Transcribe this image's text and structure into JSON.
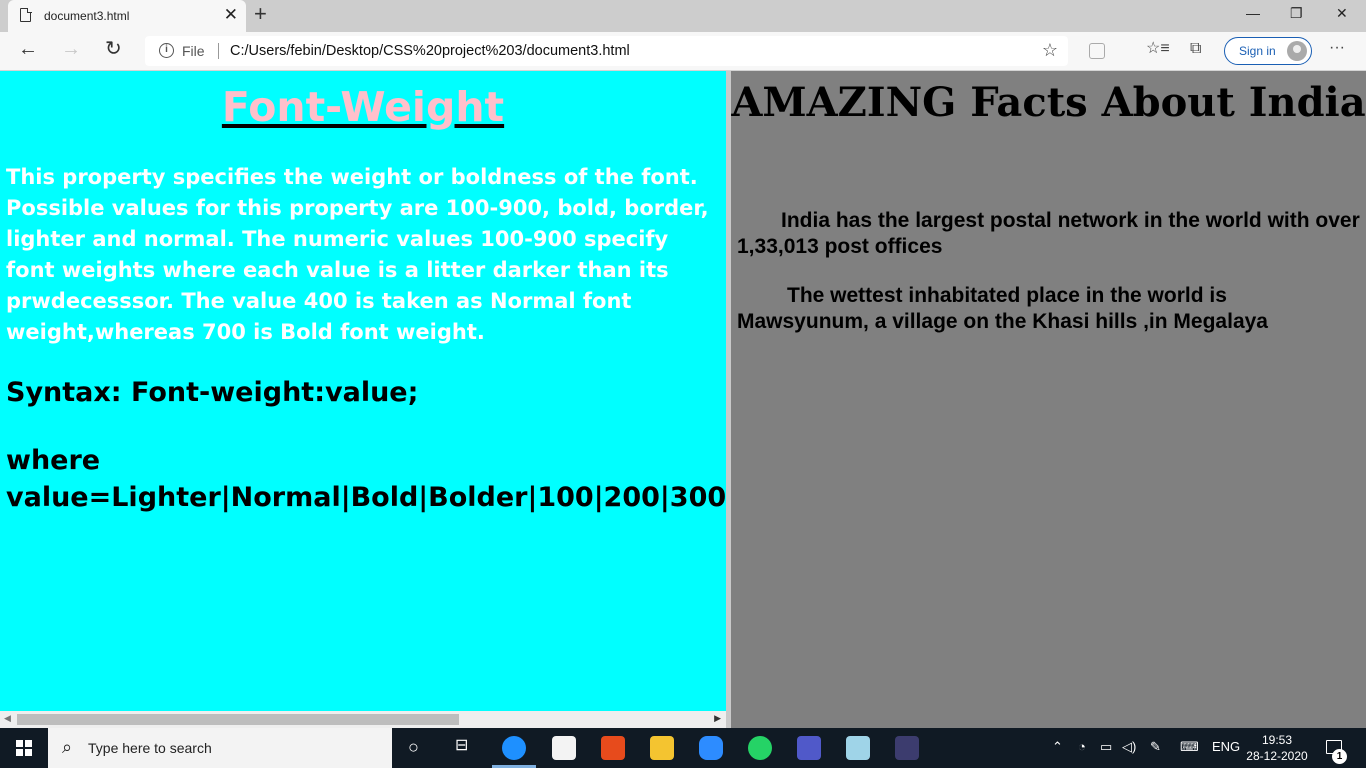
{
  "browser": {
    "tab_title": "document3.html",
    "tab_close": "✕",
    "new_tab": "+",
    "window_controls": {
      "minimize": "—",
      "restore": "❐",
      "close": "✕"
    },
    "scheme_label": "File",
    "url": "C:/Users/febin/Desktop/CSS%20project%203/document3.html",
    "sign_in_label": "Sign in",
    "more_label": "···"
  },
  "left_pane": {
    "title": "Font-Weight",
    "description": "This property specifies the weight or boldness of the font. Possible values for this property are 100-900, bold, border, lighter and normal. The numeric values 100-900 specify font weights where each value is a litter darker than its prwdecesssor. The value 400 is taken as Normal font weight,whereas 700 is Bold font weight.",
    "syntax": "Syntax: Font-weight:value;",
    "where": "where",
    "value_line": "value=Lighter|Normal|Bold|Bolder|100|200|300",
    "bg_color": "#00ffff",
    "title_color": "#ffc0cb"
  },
  "right_pane": {
    "title": "AMAZING Facts About India",
    "facts": [
      "India has the largest postal network in the world with over 1,33,013 post offices",
      "The wettest inhabitated place in the world is Mawsyunum, a village on the Khasi hills ,in Megalaya"
    ],
    "bg_color": "#808080"
  },
  "taskbar": {
    "search_placeholder": "Type here to search",
    "language": "ENG",
    "time": "19:53",
    "date": "28-12-2020",
    "notification_count": "1",
    "apps": [
      "task-view-icon",
      "edge-icon",
      "store-icon",
      "office-icon",
      "file-explorer-icon",
      "zoom-icon",
      "whatsapp-icon",
      "teams-icon",
      "notepad-icon",
      "vscode-icon"
    ]
  }
}
